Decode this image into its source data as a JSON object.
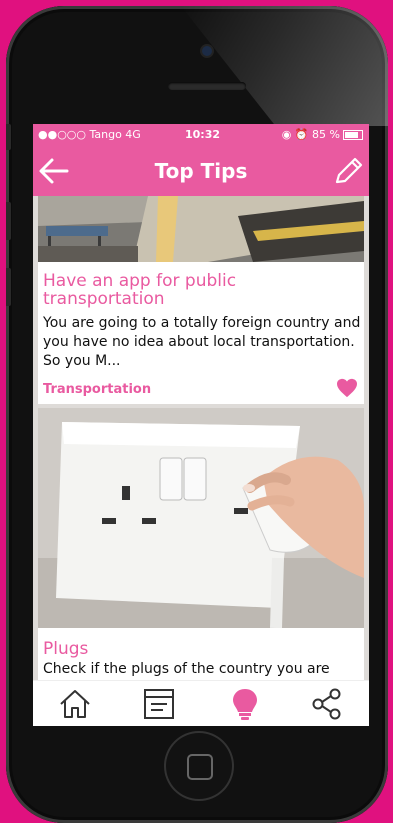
{
  "status_bar": {
    "carrier": "●●○○○ Tango  4G",
    "time": "10:32",
    "right": "◉ ⏰ 85 %"
  },
  "header": {
    "title": "Top Tips",
    "back_icon": "back-arrow-icon",
    "edit_icon": "pencil-icon"
  },
  "tips": [
    {
      "title": "Have an app for public transportation",
      "description": "You are going to a totally foreign country and you have no idea about local transportation. So you M...",
      "category": "Transportation",
      "favorited": true
    },
    {
      "title": "Plugs",
      "description": "Check if the plugs of the country you are"
    }
  ],
  "tab_bar": {
    "items": [
      {
        "icon": "home-icon",
        "active": false
      },
      {
        "icon": "document-icon",
        "active": false
      },
      {
        "icon": "lightbulb-icon",
        "active": true
      },
      {
        "icon": "share-icon",
        "active": false
      }
    ]
  },
  "colors": {
    "accent": "#e95aa0",
    "background": "#e0117f"
  }
}
